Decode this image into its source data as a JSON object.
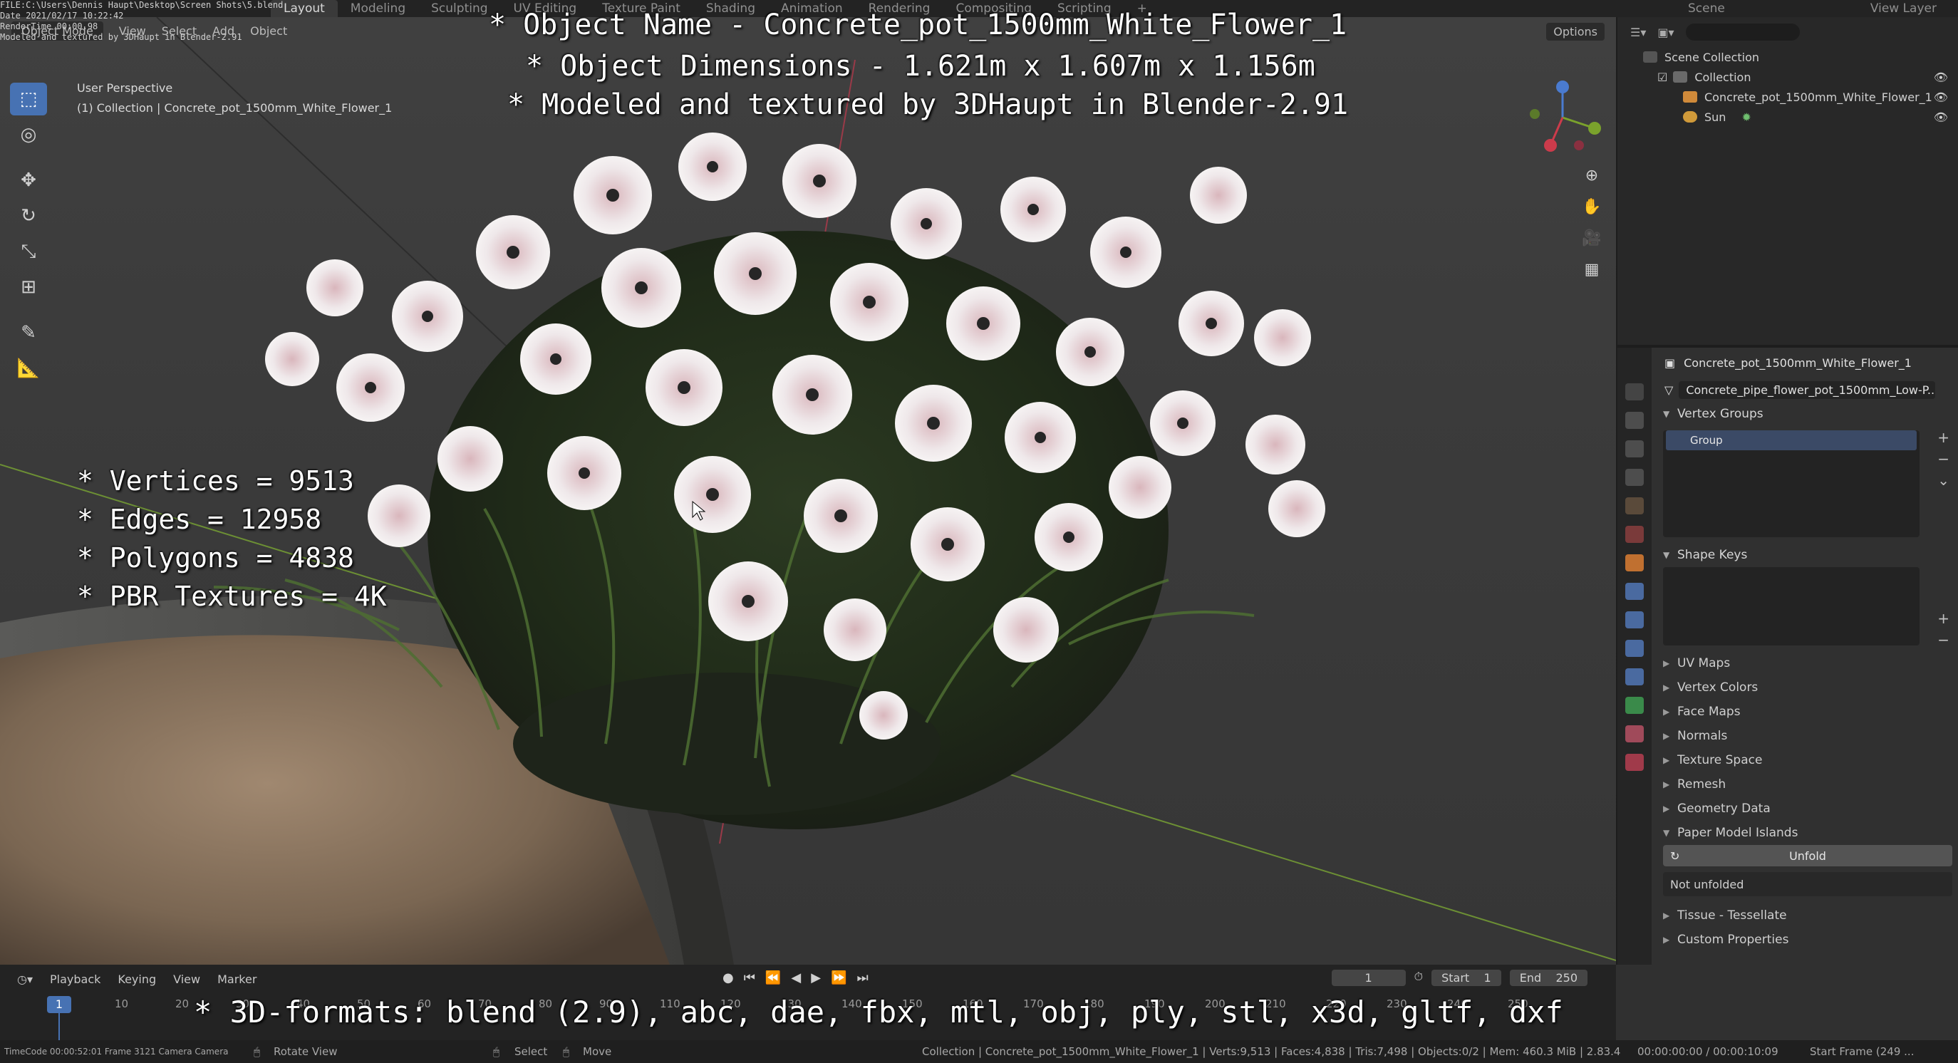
{
  "file_info": [
    "FILE:C:\\Users\\Dennis Haupt\\Desktop\\Screen Shots\\5.blend",
    "Date 2021/02/17 10:22:42",
    "RenderTime 00:00.98",
    "Modeled and textured by 3DHaupt in Blender-2.91"
  ],
  "workspaces": [
    "Layout",
    "Modeling",
    "Sculpting",
    "UV Editing",
    "Texture Paint",
    "Shading",
    "Animation",
    "Rendering",
    "Compositing",
    "Scripting"
  ],
  "topbar_right": {
    "scene": "Scene",
    "view_layer": "View Layer"
  },
  "viewport": {
    "mode": "Object Mode",
    "menus": [
      "View",
      "Select",
      "Add",
      "Object"
    ],
    "options": "Options",
    "perspective": "User Perspective",
    "collection_path": "(1) Collection | Concrete_pot_1500mm_White_Flower_1"
  },
  "overlay": {
    "title": "* Object Name - Concrete_pot_1500mm_White_Flower_1",
    "dimensions": "* Object Dimensions -  1.621m x 1.607m x 1.156m",
    "credit": "* Modeled and textured by 3DHaupt in Blender-2.91",
    "stats": [
      "* Vertices = 9513",
      "* Edges = 12958",
      "* Polygons = 4838",
      "* PBR Textures = 4K"
    ],
    "formats": "* 3D-formats: blend (2.9), abc, dae, fbx, mtl, obj, ply, stl, x3d, gltf, dxf"
  },
  "outliner": {
    "scene_collection": "Scene Collection",
    "collection": "Collection",
    "object": "Concrete_pot_1500mm_White_Flower_1",
    "sun": "Sun"
  },
  "properties": {
    "object_name": "Concrete_pot_1500mm_White_Flower_1",
    "mesh_name": "Concrete_pipe_flower_pot_1500mm_Low-P...",
    "vertex_groups_title": "Vertex Groups",
    "vertex_group_item": "Group",
    "shape_keys_title": "Shape Keys",
    "sections": [
      "UV Maps",
      "Vertex Colors",
      "Face Maps",
      "Normals",
      "Texture Space",
      "Remesh",
      "Geometry Data"
    ],
    "paper_model_title": "Paper Model Islands",
    "unfold_label": "Unfold",
    "unfold_status": "Not unfolded",
    "tissue": "Tissue - Tessellate",
    "custom_props": "Custom Properties"
  },
  "timeline": {
    "menus": [
      "Playback",
      "Keying",
      "View",
      "Marker"
    ],
    "current_frame": "1",
    "start_label": "Start",
    "start": "1",
    "end_label": "End",
    "end": "250",
    "ruler": [
      "1",
      "10",
      "20",
      "30",
      "40",
      "50",
      "60",
      "70",
      "80",
      "90",
      "110",
      "120",
      "130",
      "140",
      "150",
      "160",
      "170",
      "180",
      "190",
      "200",
      "210",
      "220",
      "230",
      "240",
      "250"
    ]
  },
  "statusbar": {
    "rotate": "Rotate View",
    "select": "Select",
    "move": "Move",
    "info": "Collection | Concrete_pot_1500mm_White_Flower_1 | Verts:9,513 | Faces:4,838 | Tris:7,498 | Objects:0/2 | Mem: 460.3 MiB | 2.83.4",
    "time": "00:00:00:00 / 00:00:10:09",
    "start_frame": "Start Frame (249 ...",
    "left_info": "TimeCode 00:00:52:01  Frame 3121  Camera Camera"
  },
  "colors": {
    "accent": "#4772b3",
    "selected_row": "#3b4a66",
    "viewport_bg": "#3d3d3d"
  }
}
